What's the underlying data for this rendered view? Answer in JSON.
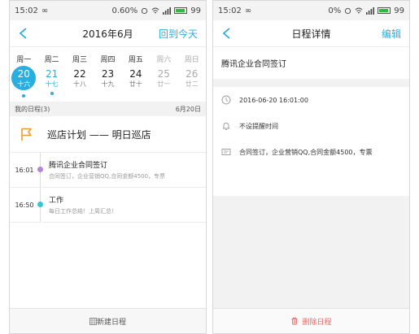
{
  "left": {
    "status": {
      "time": "15:02",
      "infinity": "∞",
      "speed": "0.60%",
      "battery": "99"
    },
    "nav": {
      "title": "2016年6月",
      "action": "回到今天"
    },
    "weekdays": [
      "周一",
      "周二",
      "周三",
      "周四",
      "周五",
      "周六",
      "周日"
    ],
    "days": [
      {
        "num": "20",
        "lunar": "十六"
      },
      {
        "num": "21",
        "lunar": "十七"
      },
      {
        "num": "22",
        "lunar": "十八"
      },
      {
        "num": "23",
        "lunar": "十九"
      },
      {
        "num": "24",
        "lunar": "廿十"
      },
      {
        "num": "25",
        "lunar": "廿一"
      },
      {
        "num": "26",
        "lunar": "廿二"
      }
    ],
    "section": {
      "label": "我的日程(3)",
      "date": "6月20日"
    },
    "plan": {
      "text": "巡店计划 —— 明日巡店"
    },
    "events": [
      {
        "time": "16:01",
        "title": "腾讯企业合同签订",
        "desc": "合同签订，企业营销QQ,合同金额4500，专票",
        "color": "#b583d9"
      },
      {
        "time": "16:50",
        "title": "工作",
        "desc": "每日工作总结！上周汇总！",
        "color": "#35c6d6"
      }
    ],
    "bottom": {
      "label": "新建日程"
    }
  },
  "right": {
    "status": {
      "time": "15:02",
      "infinity": "∞",
      "speed": "0%",
      "battery": "99"
    },
    "nav": {
      "title": "日程详情",
      "action": "编辑"
    },
    "title": "腾讯企业合同签订",
    "datetime": "2016-06-20 16:01:00",
    "reminder": "不设提醒时间",
    "note": "合同签订，企业营销QQ,合同金额4500，专票",
    "bottom": {
      "label": "删除日程"
    }
  },
  "colors": {
    "accent": "#29aee0",
    "danger": "#ee6666"
  }
}
